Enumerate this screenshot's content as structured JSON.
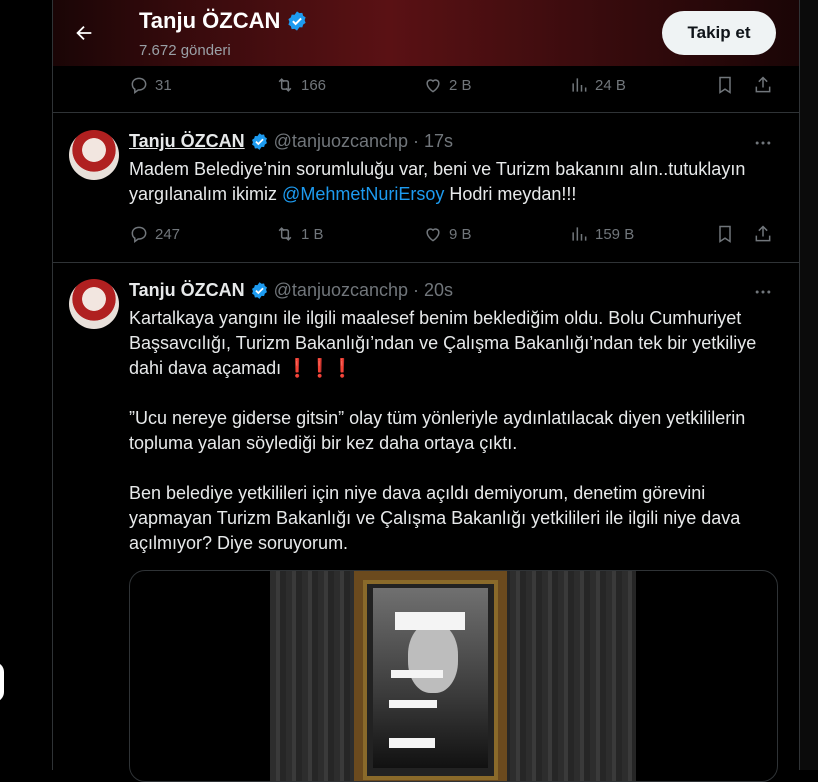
{
  "header": {
    "back_label": "back",
    "name": "Tanju ÖZCAN",
    "post_count": "7.672 gönderi",
    "follow_label": "Takip et"
  },
  "prev_tweet_actions": {
    "replies": "31",
    "reposts": "166",
    "likes": "2 B",
    "views": "24 B"
  },
  "tweets": [
    {
      "name": "Tanju ÖZCAN",
      "handle": "@tanjuozcanchp",
      "sep": "·",
      "time": "17s",
      "text_before": "Madem Belediye’nin sorumluluğu var, beni ve Turizm bakanını alın..tutuklayın yargılanalım ikimiz ",
      "mention": "@MehmetNuriErsoy",
      "text_after": " Hodri meydan!!!",
      "replies": "247",
      "reposts": "1 B",
      "likes": "9 B",
      "views": "159 B"
    },
    {
      "name": "Tanju ÖZCAN",
      "handle": "@tanjuozcanchp",
      "sep": "·",
      "time": "20s",
      "para1": "Kartalkaya yangını ile ilgili maalesef benim beklediğim oldu. Bolu Cumhuriyet Başsavcılığı, Turizm Bakanlığı’ndan ve Çalışma Bakanlığı’ndan tek bir yetkiliye dahi dava açamadı",
      "para1_emoji": "❗️❗️❗️",
      "para2": "”Ucu nereye giderse gitsin” olay tüm yönleriyle aydınlatılacak diyen yetkililerin topluma yalan söylediği bir kez daha ortaya çıktı.",
      "para3": "Ben belediye yetkilileri için niye dava açıldı demiyorum, denetim görevini yapmayan Turizm Bakanlığı ve Çalışma Bakanlığı yetkilileri ile ilgili niye dava açılmıyor? Diye soruyorum."
    }
  ],
  "colors": {
    "accent": "#1d9bf0",
    "muted": "#71767b",
    "text": "#e7e9ea",
    "border": "#2f3336"
  },
  "icons": [
    "back-arrow-icon",
    "verified-badge-icon",
    "reply-icon",
    "repost-icon",
    "like-icon",
    "views-icon",
    "bookmark-icon",
    "share-icon",
    "more-icon"
  ]
}
